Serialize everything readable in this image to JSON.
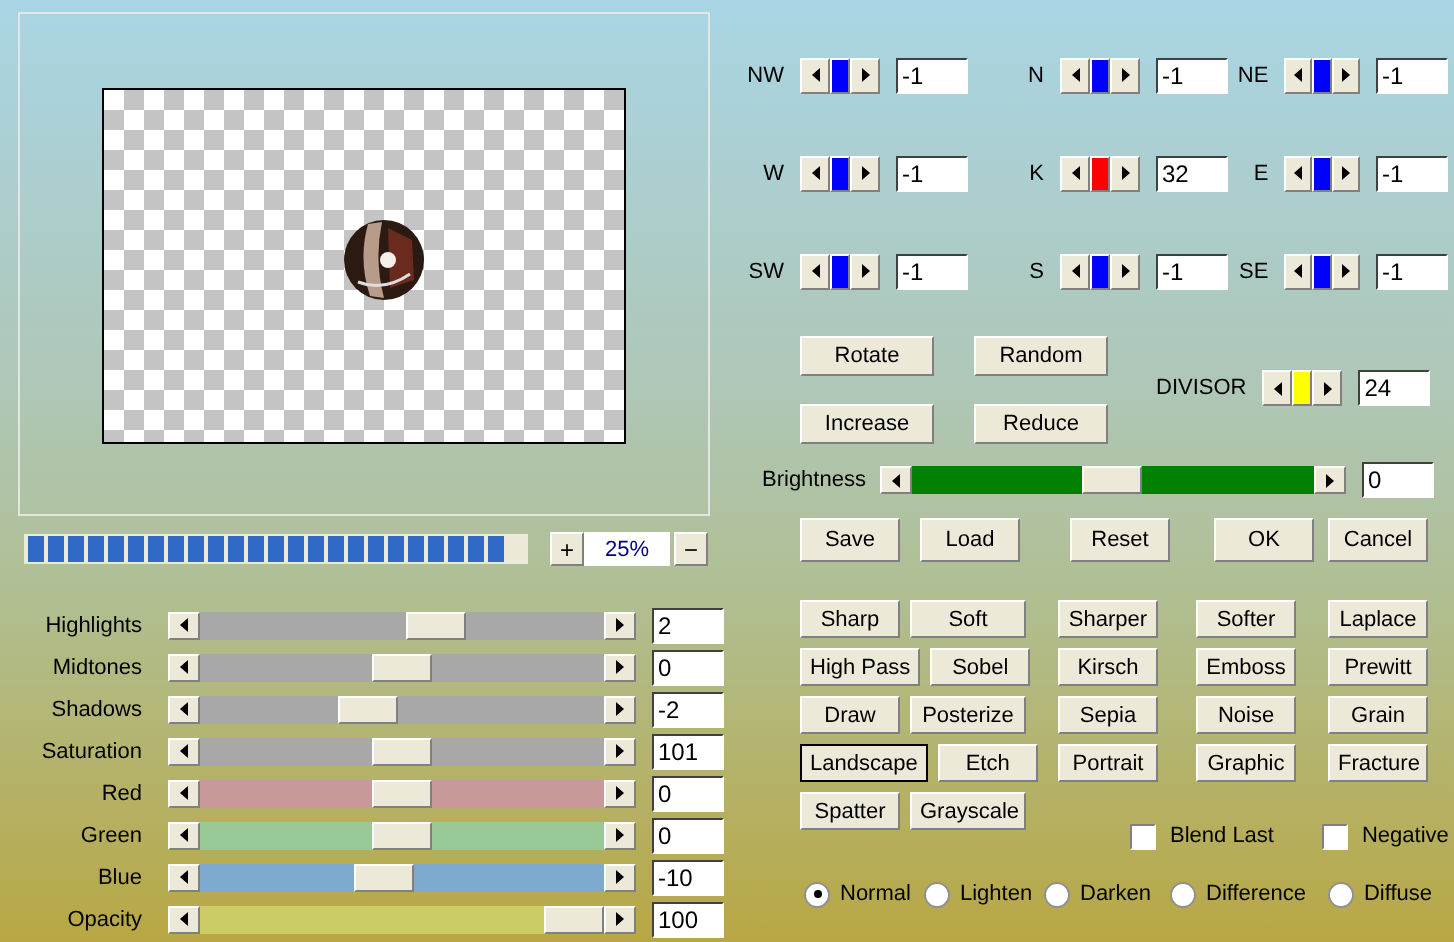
{
  "zoom": {
    "level": 1,
    "minus": "−",
    "plus": "+",
    "value": "25%"
  },
  "adjust_sliders": [
    {
      "label": "Highlights",
      "level": 0.6,
      "value": "2",
      "color": "#a8a8a8"
    },
    {
      "label": "Midtones",
      "level": 0.5,
      "value": "0",
      "color": "#a8a8a8"
    },
    {
      "label": "Shadows",
      "level": 0.4,
      "value": "-2",
      "color": "#a8a8a8"
    },
    {
      "label": "Saturation",
      "level": 0.5,
      "value": "101",
      "color": "#a8a8a8"
    },
    {
      "label": "Red",
      "level": 0.5,
      "value": "0",
      "color": "#c99898"
    },
    {
      "label": "Green",
      "level": 0.5,
      "value": "0",
      "color": "#97c896"
    },
    {
      "label": "Blue",
      "level": 0.45,
      "value": "-10",
      "color": "#7eaad0"
    },
    {
      "label": "Opacity",
      "level": 1,
      "value": "100",
      "color": "#cccc66"
    }
  ],
  "kernel": [
    [
      {
        "label": "NW",
        "level": 0.5,
        "value": "-1",
        "color": "#0000ff"
      },
      {
        "label": "N",
        "level": 0.5,
        "value": "-1",
        "color": "#0000ff"
      },
      {
        "label": "NE",
        "level": 0.5,
        "value": "-1",
        "color": "#0000ff"
      }
    ],
    [
      {
        "label": "W",
        "level": 0.5,
        "value": "-1",
        "color": "#0000ff"
      },
      {
        "label": "K",
        "level": 0.5,
        "value": "32",
        "color": "#ff0000"
      },
      {
        "label": "E",
        "level": 0.5,
        "value": "-1",
        "color": "#0000ff"
      }
    ],
    [
      {
        "label": "SW",
        "level": 0.5,
        "value": "-1",
        "color": "#0000ff"
      },
      {
        "label": "S",
        "level": 0.5,
        "value": "-1",
        "color": "#0000ff"
      },
      {
        "label": "SE",
        "level": 0.5,
        "value": "-1",
        "color": "#0000ff"
      }
    ]
  ],
  "kernel_buttons": [
    [
      "Rotate",
      "Random"
    ],
    [
      "Increase",
      "Reduce"
    ]
  ],
  "divisor": {
    "label": "DIVISOR",
    "level": 0.5,
    "value": "24",
    "color": "#ffff00"
  },
  "brightness": {
    "label": "Brightness",
    "level": 0.5,
    "value": "0"
  },
  "action_buttons": [
    "Save",
    "Load",
    "Reset",
    "OK",
    "Cancel"
  ],
  "filter_buttons": [
    [
      {
        "label": "Sharp",
        "focused": false
      },
      {
        "label": "Soft",
        "focused": false
      },
      {
        "label": "Sharper",
        "focused": false
      },
      {
        "label": "Softer",
        "focused": false
      },
      {
        "label": "Laplace",
        "focused": false
      }
    ],
    [
      {
        "label": "High Pass",
        "focused": false
      },
      {
        "label": "Sobel",
        "focused": false
      },
      {
        "label": "Kirsch",
        "focused": false
      },
      {
        "label": "Emboss",
        "focused": false
      },
      {
        "label": "Prewitt",
        "focused": false
      }
    ],
    [
      {
        "label": "Draw",
        "focused": false
      },
      {
        "label": "Posterize",
        "focused": false
      },
      {
        "label": "Sepia",
        "focused": false
      },
      {
        "label": "Noise",
        "focused": false
      },
      {
        "label": "Grain",
        "focused": false
      }
    ],
    [
      {
        "label": "Landscape",
        "focused": true
      },
      {
        "label": "Etch",
        "focused": false
      },
      {
        "label": "Portrait",
        "focused": false
      },
      {
        "label": "Graphic",
        "focused": false
      },
      {
        "label": "Fracture",
        "focused": false
      }
    ],
    [
      {
        "label": "Spatter",
        "focused": false
      },
      {
        "label": "Grayscale",
        "focused": false
      }
    ]
  ],
  "checkboxes": [
    {
      "label": "Blend Last",
      "checked": false
    },
    {
      "label": "Negative",
      "checked": false
    }
  ],
  "blend_modes": [
    {
      "label": "Normal",
      "selected": true
    },
    {
      "label": "Lighten",
      "selected": false
    },
    {
      "label": "Darken",
      "selected": false
    },
    {
      "label": "Difference",
      "selected": false
    },
    {
      "label": "Diffuse",
      "selected": false
    }
  ]
}
